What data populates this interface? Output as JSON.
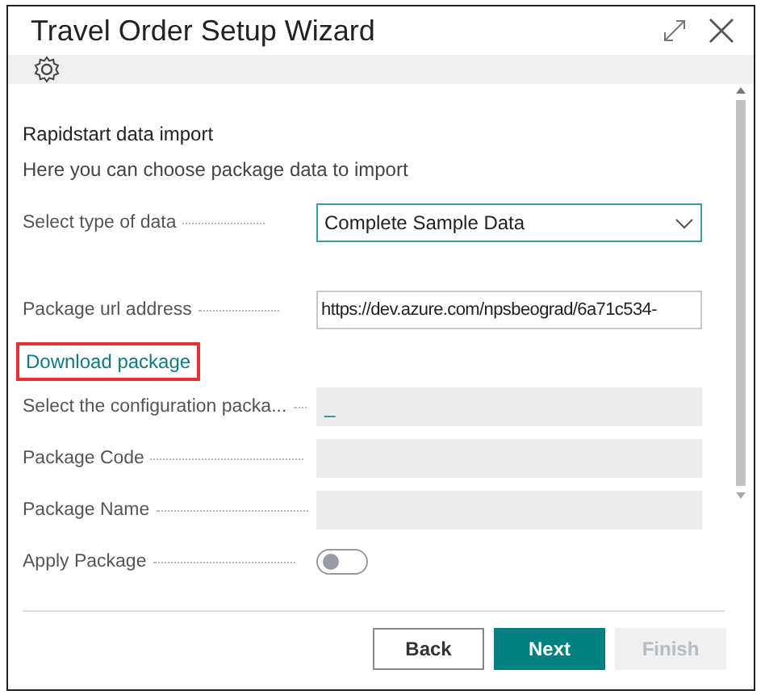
{
  "window": {
    "title": "Travel Order Setup Wizard"
  },
  "section": {
    "title": "Rapidstart data import",
    "description": "Here you can choose package data to import"
  },
  "fields": [
    {
      "kind": "select",
      "label": "Select type of data",
      "value": "Complete Sample Data"
    },
    {
      "kind": "text",
      "label": "Package url address",
      "value": "https://dev.azure.com/npsbeograd/6a71c534-"
    },
    {
      "kind": "link",
      "label": "Download package",
      "highlighted": true
    },
    {
      "kind": "readonly",
      "label": "Select the configuration packa...",
      "value": "_"
    },
    {
      "kind": "readonly",
      "label": "Package Code"
    },
    {
      "kind": "readonly",
      "label": "Package Name"
    },
    {
      "kind": "toggle",
      "label": "Apply Package",
      "on": false
    }
  ],
  "buttons": [
    {
      "label": "Back",
      "kind": "default"
    },
    {
      "label": "Next",
      "kind": "primary"
    },
    {
      "label": "Finish",
      "kind": "disabled"
    }
  ]
}
